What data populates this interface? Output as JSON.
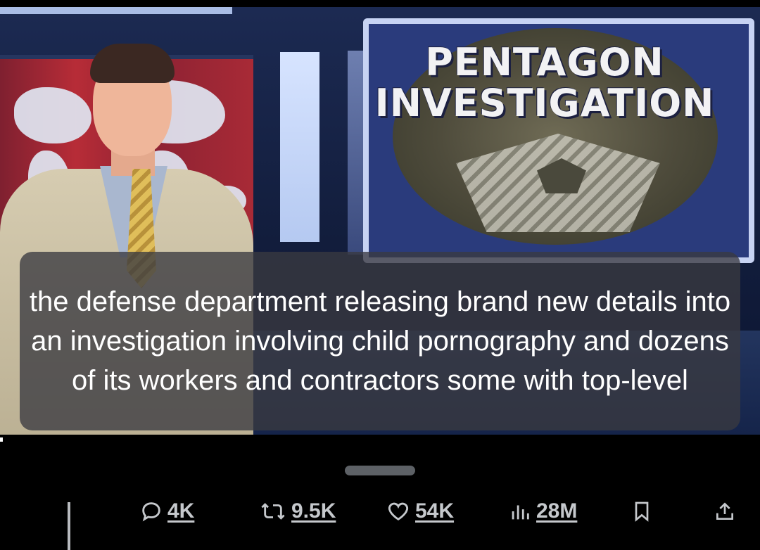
{
  "video": {
    "graphic_title_line1": "PENTAGON",
    "graphic_title_line2": "INVESTIGATION",
    "caption": "the defense department releasing brand new details into an investigation involving child pornography and dozens of its workers and contractors some with top-level"
  },
  "actions": {
    "reply": {
      "icon": "reply-icon",
      "count": "4K"
    },
    "retweet": {
      "icon": "retweet-icon",
      "count": "9.5K"
    },
    "like": {
      "icon": "heart-icon",
      "count": "54K"
    },
    "views": {
      "icon": "views-chart-icon",
      "count": "28M"
    },
    "bookmark": {
      "icon": "bookmark-icon"
    },
    "share": {
      "icon": "share-icon"
    }
  },
  "colors": {
    "background": "#000000",
    "action_text": "#c5c8cc",
    "caption_bg": "#3a3a40"
  }
}
